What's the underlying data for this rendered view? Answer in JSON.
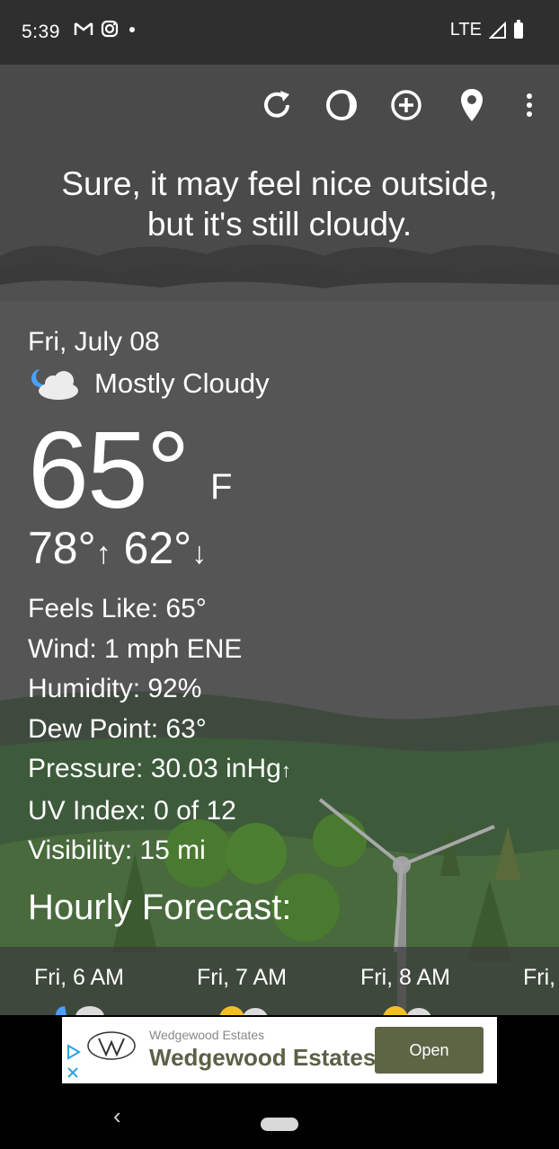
{
  "status_bar": {
    "time": "5:39",
    "network": "LTE"
  },
  "toolbar": {
    "refresh_icon": "refresh-icon",
    "theme_icon": "theme-icon",
    "add_icon": "add-location-icon",
    "location_icon": "location-pin-icon",
    "more_icon": "more-vert-icon"
  },
  "headline": {
    "line1": "Sure, it may feel nice outside,",
    "line2": "but it's still cloudy."
  },
  "current": {
    "date": "Fri, July 08",
    "condition": "Mostly Cloudy",
    "temperature": "65°",
    "unit": "F",
    "high": "78°",
    "low": "62°",
    "feels_like": "Feels Like:  65°",
    "wind": "Wind:  1 mph ENE",
    "humidity": "Humidity:  92%",
    "dew_point": "Dew Point:  63°",
    "pressure": "Pressure:  30.03 inHg",
    "uv_index": "UV Index:  0 of 12",
    "visibility": "Visibility:  15 mi"
  },
  "hourly": {
    "title": "Hourly Forecast:",
    "items": [
      {
        "label": "Fri, 6 AM"
      },
      {
        "label": "Fri, 7 AM"
      },
      {
        "label": "Fri, 8 AM"
      },
      {
        "label": "Fri,"
      }
    ]
  },
  "ad": {
    "sponsor": "Wedgewood Estates",
    "title": "Wedgewood Estates",
    "button": "Open"
  },
  "colors": {
    "background": "#555555",
    "status_bar": "#2f2f2f",
    "ad_button": "#5d6545"
  }
}
